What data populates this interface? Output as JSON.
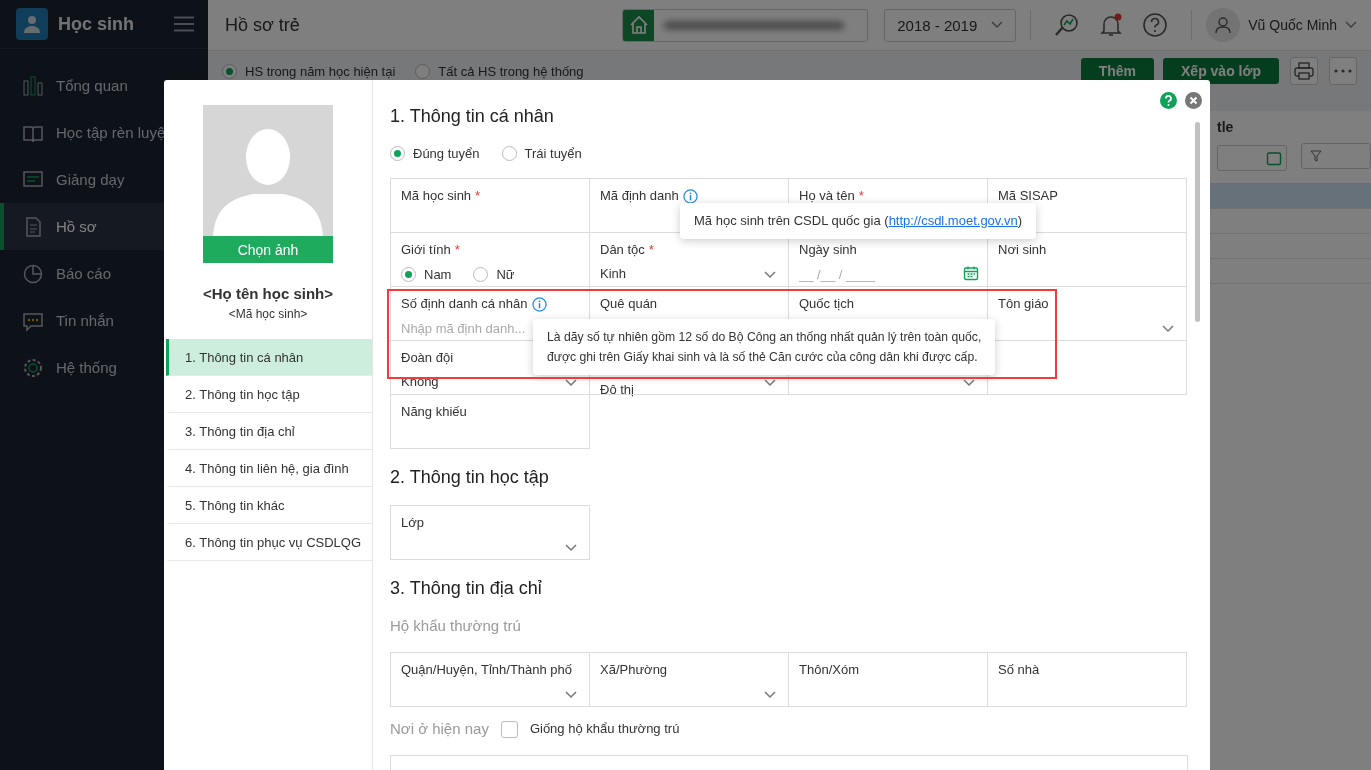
{
  "app": {
    "title": "Học sinh"
  },
  "sidebar": {
    "items": [
      {
        "label": "Tổng quan",
        "selected": false
      },
      {
        "label": "Học tập rèn luyệ",
        "selected": false
      },
      {
        "label": "Giảng dạy",
        "selected": false
      },
      {
        "label": "Hồ sơ",
        "selected": true
      },
      {
        "label": "Báo cáo",
        "selected": false
      },
      {
        "label": "Tin nhắn",
        "selected": false
      },
      {
        "label": "Hệ thống",
        "selected": false
      }
    ]
  },
  "header": {
    "page_title": "Hồ sơ trẻ",
    "school_year": "2018 - 2019",
    "user_name": "Vũ Quốc Minh",
    "notification_unread": true
  },
  "toolbar": {
    "scope_options": [
      {
        "label": "HS trong năm học hiện tại",
        "selected": true
      },
      {
        "label": "Tất cả HS trong hệ thống",
        "selected": false
      }
    ],
    "buttons": [
      "Thêm",
      "Xếp vào lớp"
    ]
  },
  "table": {
    "column_fragment": "tle"
  },
  "dialog": {
    "photo_button": "Chọn ảnh",
    "student_name": "<Họ tên học sinh>",
    "student_code": "<Mã học sinh>",
    "sections": [
      {
        "label": "1. Thông tin cá nhân",
        "selected": true
      },
      {
        "label": "2. Thông tin học tập",
        "selected": false
      },
      {
        "label": "3. Thông tin địa chỉ",
        "selected": false
      },
      {
        "label": "4. Thông tin liên hệ, gia đình",
        "selected": false
      },
      {
        "label": "5. Thông tin khác",
        "selected": false
      },
      {
        "label": "6. Thông tin phục vụ CSDLQG",
        "selected": false
      }
    ],
    "personal": {
      "title": "1. Thông tin cá nhân",
      "admission_options": [
        {
          "label": "Đúng tuyển",
          "selected": true
        },
        {
          "label": "Trái tuyển",
          "selected": false
        }
      ],
      "fields": [
        {
          "kind": "text",
          "label": "Mã học sinh",
          "required_mark": "*"
        },
        {
          "kind": "text",
          "label": "Mã định danh",
          "info": true,
          "tooltip": {
            "text": "Mã học sinh trên CSDL quốc gia (",
            "link": "http://csdl.moet.gov.vn",
            "text_after": ")"
          }
        },
        {
          "kind": "text",
          "label": "Họ và tên",
          "required_mark": "*"
        },
        {
          "kind": "text",
          "label": "Mã SISAP"
        },
        {
          "kind": "radio",
          "label": "Giới tính",
          "required_mark": "*",
          "options": [
            {
              "label": "Nam",
              "selected": true
            },
            {
              "label": "Nữ",
              "selected": false
            }
          ]
        },
        {
          "kind": "select",
          "label": "Dân tộc",
          "required_mark": "*",
          "value": "Kinh"
        },
        {
          "kind": "date",
          "label": "Ngày sinh",
          "placeholder": "__ /__ / ____"
        },
        {
          "kind": "text",
          "label": "Nơi sinh"
        },
        {
          "kind": "text",
          "label": "Số định danh cá nhân",
          "info": true,
          "placeholder": "Nhập mã định danh...",
          "tooltip": {
            "lines": [
              "Là dãy số tự nhiên gồm 12 số do Bộ Công an thống nhất quản lý trên toàn quốc,",
              "được ghi trên Giấy khai sinh và là số thẻ Căn cước của công dân khi được cấp."
            ],
            "highlighted": true
          }
        },
        {
          "kind": "text",
          "label": "Quê quán"
        },
        {
          "kind": "text",
          "label": "Quốc tịch"
        },
        {
          "kind": "select",
          "label": "Tôn giáo"
        },
        {
          "kind": "select",
          "label": "Đoàn đội",
          "value": "Không"
        },
        {
          "kind": "select",
          "value": "Đô thị"
        },
        {
          "kind": "select"
        },
        {
          "kind": "blank"
        },
        {
          "kind": "text",
          "label": "Năng khiếu"
        }
      ]
    },
    "study": {
      "title": "2. Thông tin học tập",
      "fields": [
        {
          "kind": "select",
          "label": "Lớp"
        }
      ]
    },
    "address": {
      "title": "3. Thông tin địa chỉ",
      "permanent_label": "Hộ khẩu thường trú",
      "fields": [
        {
          "kind": "select",
          "label": "Quận/Huyện, Tỉnh/Thành phố"
        },
        {
          "kind": "select",
          "label": "Xã/Phường"
        },
        {
          "kind": "text",
          "label": "Thôn/Xóm"
        },
        {
          "kind": "text",
          "label": "Số nhà"
        }
      ],
      "current_label": "Nơi ở hiện nay",
      "same_as_permanent": {
        "label": "Giống hộ khẩu thường trú",
        "checked": false
      }
    }
  }
}
